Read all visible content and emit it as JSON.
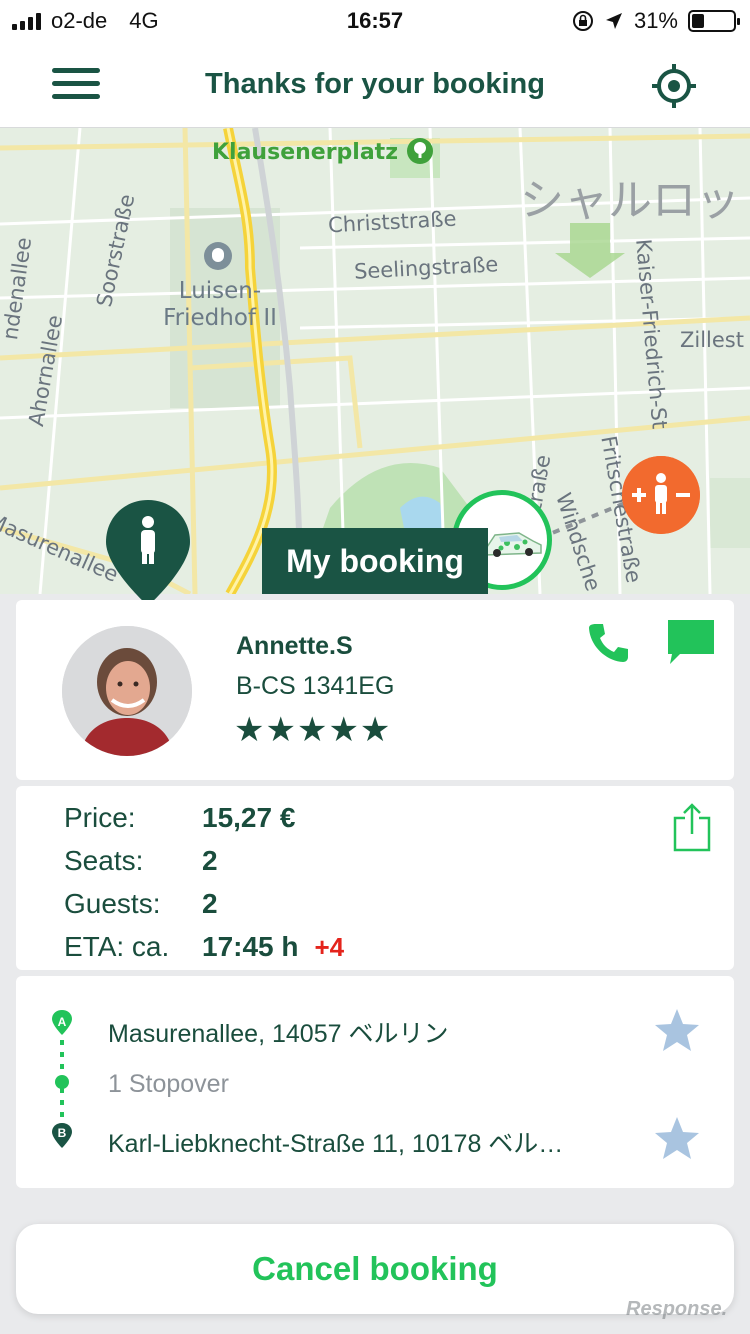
{
  "status_bar": {
    "carrier": "o2-de",
    "network": "4G",
    "time": "16:57",
    "battery_percent": "31%",
    "battery_level": 0.31
  },
  "header": {
    "title": "Thanks for your booking"
  },
  "map": {
    "labels": {
      "klausenerplatz": "Klausenerplatz",
      "christstrasse": "Christstraße",
      "seelingstrasse": "Seelingstraße",
      "kaiser_friedrich": "Kaiser-Friedrich-St",
      "zillest": "Zillest",
      "japanese": "シャルロッ",
      "soorstrasse": "Soorstraße",
      "ahornallee": "Ahornallee",
      "lindenallee": "ndenallee",
      "luisen": "Luisen-",
      "friedhof": "Friedhof II",
      "masurenallee": "Masurenallee",
      "windscheid": "Windsche",
      "fritsche": "Fritschestraße",
      "strasse": "traße"
    },
    "my_booking_label": "My booking"
  },
  "driver": {
    "name": "Annette.S",
    "plate": "B-CS 1341EG",
    "rating_stars": "★★★★★",
    "rating": 5
  },
  "booking": {
    "price_label": "Price:",
    "price_value": "15,27 €",
    "seats_label": "Seats:",
    "seats_value": "2",
    "guests_label": "Guests:",
    "guests_value": "2",
    "eta_label": "ETA: ca.",
    "eta_value": "17:45 h",
    "eta_delta": "+4"
  },
  "route": {
    "start_marker": "A",
    "end_marker": "B",
    "start_address": "Masurenallee, 14057 ベルリン",
    "stopover": "1 Stopover",
    "end_address": "Karl-Liebknecht-Straße 11, 10178 ベル…"
  },
  "actions": {
    "cancel_label": "Cancel booking"
  },
  "watermark": "Response.",
  "colors": {
    "brand_dark": "#1a5444",
    "accent_green": "#22c35a",
    "guest_orange": "#f26a2e",
    "delta_red": "#e4241c",
    "favorite_star": "#a9c4e0"
  }
}
